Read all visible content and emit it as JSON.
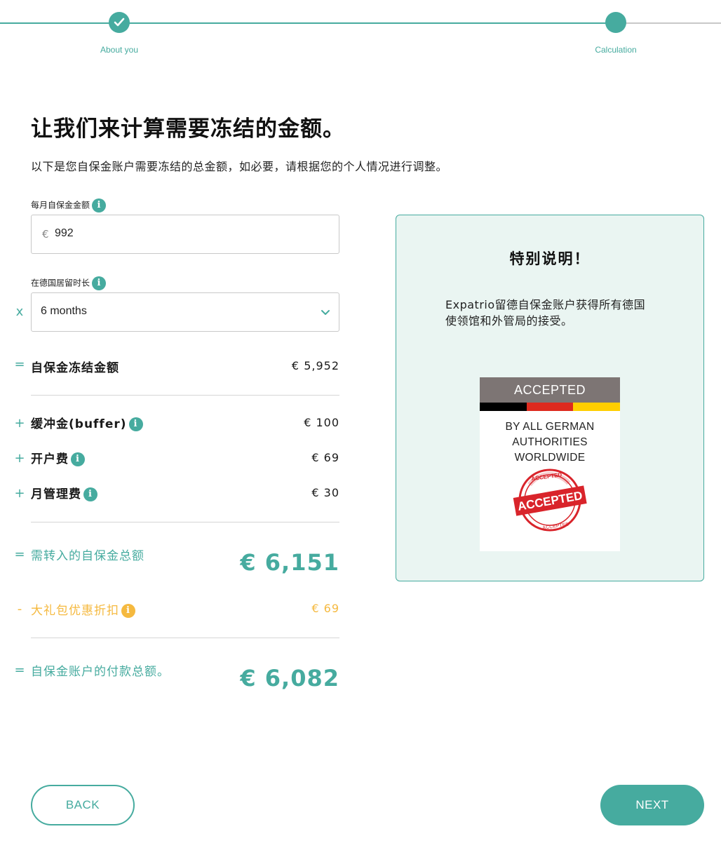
{
  "stepper": {
    "steps": [
      {
        "label": "About you",
        "status": "done"
      },
      {
        "label": "Calculation",
        "status": "current"
      }
    ]
  },
  "page": {
    "title": "让我们来计算需要冻结的金额。",
    "subtitle": "以下是您自保金账户需要冻结的总金额，如必要，请根据您的个人情况进行调整。"
  },
  "monthly_amount": {
    "label": "每月自保金金额",
    "currency": "€",
    "value": "992"
  },
  "duration": {
    "operator": "x",
    "label": "在德国居留时长",
    "selected": "6 months"
  },
  "blocked_amount": {
    "operator": "=",
    "label": "自保金冻结金额",
    "value": "€ 5,952"
  },
  "fees": [
    {
      "operator": "+",
      "label": "缓冲金(buffer)",
      "value": "€ 100"
    },
    {
      "operator": "+",
      "label": "开户费",
      "value": "€ 69"
    },
    {
      "operator": "+",
      "label": "月管理费",
      "value": "€ 30"
    }
  ],
  "transfer_total": {
    "operator": "=",
    "label": "需转入的自保金总额",
    "value": "€ 6,151"
  },
  "discount": {
    "operator": "-",
    "label": "大礼包优惠折扣",
    "value": "€ 69"
  },
  "payment_total": {
    "operator": "=",
    "label": "自保金账户的付款总额。",
    "value": "€ 6,082"
  },
  "info_card": {
    "title": "特别说明！",
    "text": "Expatrio留德自保金账户获得所有德国使领馆和外管局的接受。",
    "badge": {
      "header": "ACCEPTED",
      "line1": "BY ALL GERMAN",
      "line2": "AUTHORITIES",
      "line3": "WORLDWIDE",
      "stamp_text": "ACCEPTED",
      "flag_colors": [
        "#000000",
        "#dd2a1e",
        "#ffce00"
      ]
    }
  },
  "buttons": {
    "back": "BACK",
    "next": "NEXT"
  },
  "colors": {
    "accent": "#46ab9f",
    "discount": "#f5b93f",
    "card_bg": "#eaf5f2"
  },
  "icons": {
    "info": "info-icon",
    "check": "check-icon",
    "chevron": "chevron-down-icon"
  }
}
